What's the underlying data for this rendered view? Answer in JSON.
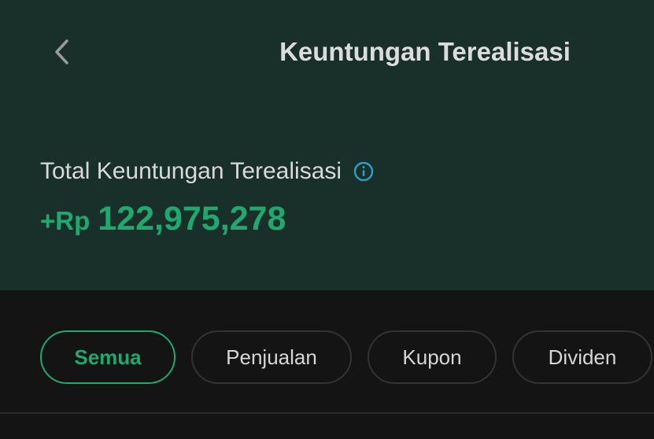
{
  "header": {
    "title": "Keuntungan Terealisasi",
    "back_icon": "chevron-left-icon"
  },
  "summary": {
    "label": "Total Keuntungan Terealisasi",
    "info_icon": "info-icon",
    "amount_prefix": "+Rp",
    "amount_value": "122,975,278",
    "amount_color": "#1fa870"
  },
  "filters": {
    "items": [
      {
        "label": "Semua",
        "active": true
      },
      {
        "label": "Penjualan",
        "active": false
      },
      {
        "label": "Kupon",
        "active": false
      },
      {
        "label": "Dividen",
        "active": false
      }
    ]
  },
  "colors": {
    "header_bg": "#19302a",
    "page_bg": "#141414",
    "accent": "#1fa870",
    "info_icon": "#2e9fc0"
  }
}
